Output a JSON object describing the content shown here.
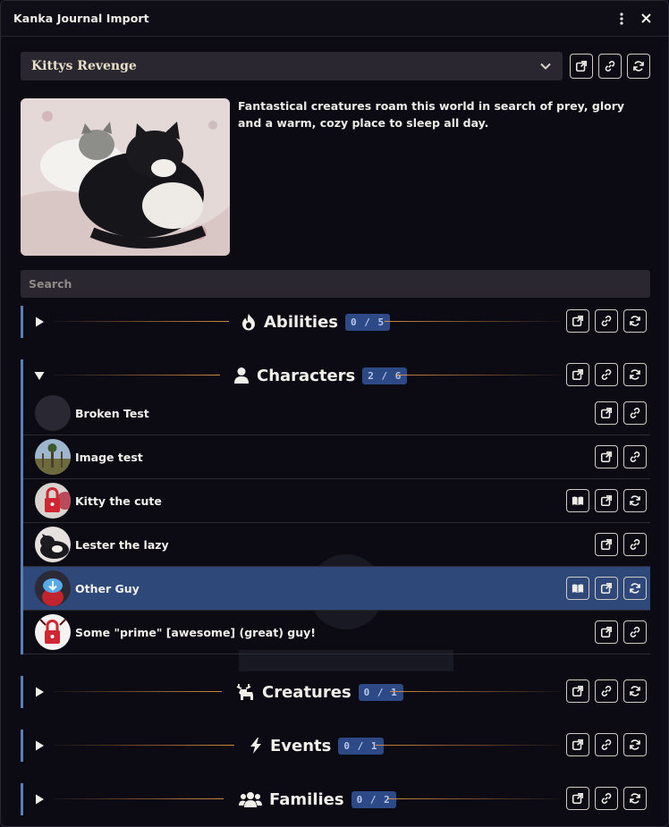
{
  "window": {
    "title": "Kanka Journal Import"
  },
  "campaign": {
    "selected": "Kittys Revenge",
    "description": "Fantastical creatures roam this world in search of prey, glory and a warm, cozy place to sleep all day."
  },
  "search": {
    "placeholder": "Search"
  },
  "sections": {
    "abilities": {
      "label": "Abilities",
      "count": "0 / 5",
      "icon": "fire-icon"
    },
    "characters": {
      "label": "Characters",
      "count": "2 / 6",
      "icon": "user-icon",
      "items": [
        {
          "name": "Broken Test",
          "icons": [
            "external-link-icon",
            "link-icon"
          ]
        },
        {
          "name": "Image test",
          "icons": [
            "external-link-icon",
            "link-icon"
          ]
        },
        {
          "name": "Kitty the cute",
          "icons": [
            "journal-icon",
            "external-link-icon",
            "sync-icon"
          ]
        },
        {
          "name": "Lester the lazy",
          "icons": [
            "external-link-icon",
            "link-icon"
          ]
        },
        {
          "name": "Other Guy",
          "icons": [
            "journal-icon",
            "external-link-icon",
            "sync-icon"
          ]
        },
        {
          "name": "Some \"prime\" [awesome] (great) guy!",
          "icons": [
            "external-link-icon",
            "link-icon"
          ]
        }
      ]
    },
    "creatures": {
      "label": "Creatures",
      "count": "0 / 1",
      "icon": "deer-icon"
    },
    "events": {
      "label": "Events",
      "count": "0 / 1",
      "icon": "bolt-icon"
    },
    "families": {
      "label": "Families",
      "count": "0 / 2",
      "icon": "users-icon"
    }
  },
  "colors": {
    "accent": "#5680b8",
    "badge": "#2d4a86",
    "selected_row": "#2e4979",
    "line": "#e29648"
  }
}
